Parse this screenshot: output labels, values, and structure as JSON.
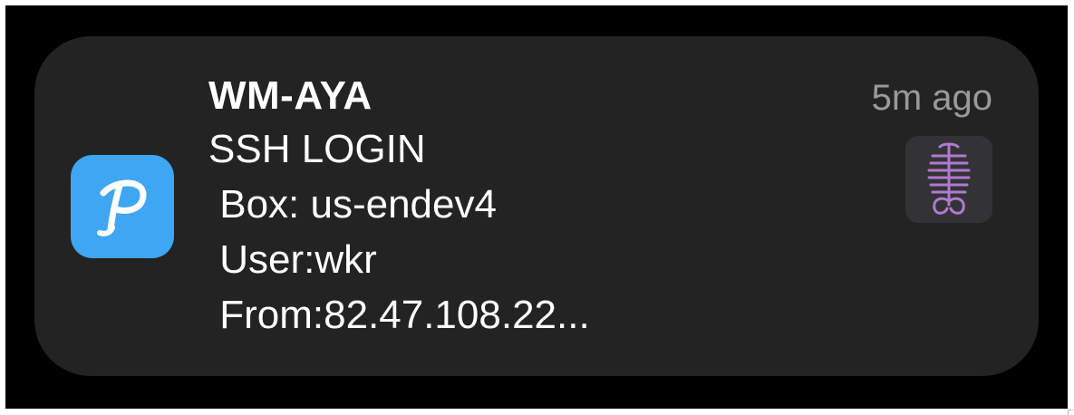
{
  "notification": {
    "app_icon": "pushover-p-icon",
    "title": "WM-AYA",
    "subtitle": "SSH LOGIN",
    "body_lines": [
      " Box: us-endev4",
      " User:wkr",
      " From:82.47.108.22..."
    ],
    "time": "5m ago",
    "thumbnail_icon": "skeleton-glyph-icon",
    "colors": {
      "background": "#000000",
      "card": "#232323",
      "app_icon": "#3ea6f2",
      "text": "#ffffff",
      "time": "#9a9a9a",
      "thumbnail_accent": "#b07ad0"
    }
  }
}
